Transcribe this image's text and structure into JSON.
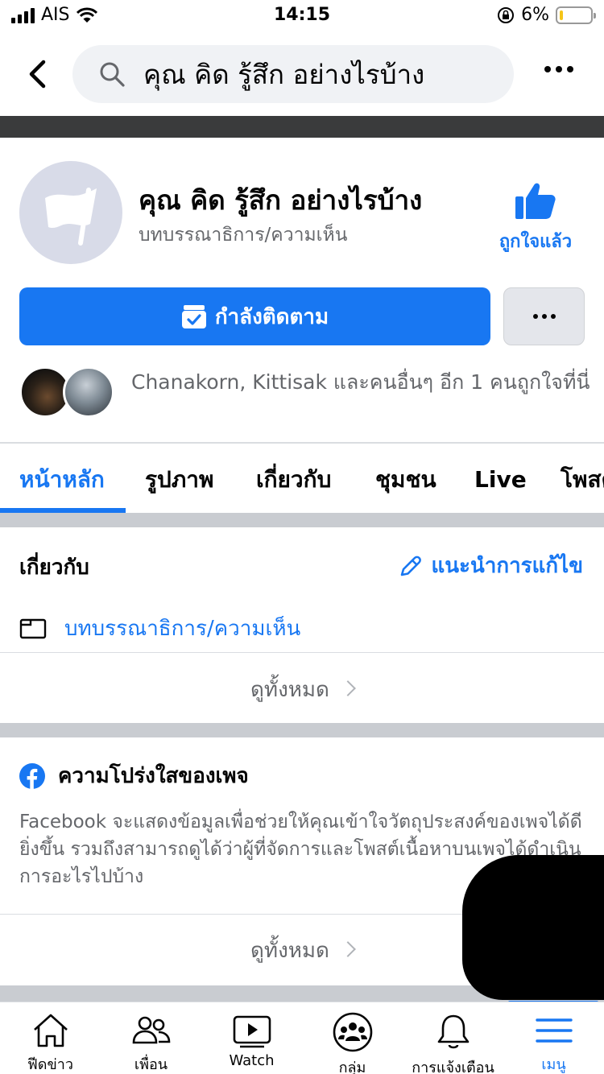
{
  "status_bar": {
    "carrier": "AIS",
    "time": "14:15",
    "battery": "6%",
    "battery_level": 0.06
  },
  "header": {
    "search_text": "คุณ คิด รู้สึก อย่างไรบ้าง"
  },
  "page": {
    "name": "คุณ คิด รู้สึก อย่างไรบ้าง",
    "category": "บทบรรณาธิการ/ความเห็น",
    "liked_label": "ถูกใจแล้ว",
    "follow_label": "กำลังติดตาม",
    "friends_text": "Chanakorn, Kittisak และคนอื่นๆ อีก 1 คนถูกใจที่นี่"
  },
  "tabs": [
    {
      "label": "หน้าหลัก",
      "active": true
    },
    {
      "label": "รูปภาพ",
      "active": false
    },
    {
      "label": "เกี่ยวกับ",
      "active": false
    },
    {
      "label": "ชุมชน",
      "active": false
    },
    {
      "label": "Live",
      "active": false
    },
    {
      "label": "โพสต์",
      "active": false
    }
  ],
  "about": {
    "title": "เกี่ยวกับ",
    "suggest_edit": "แนะนำการแก้ไข",
    "category": "บทบรรณาธิการ/ความเห็น",
    "see_all": "ดูทั้งหมด"
  },
  "transparency": {
    "title": "ความโปร่งใสของเพจ",
    "body": "Facebook จะแสดงข้อมูลเพื่อช่วยให้คุณเข้าใจวัตถุประสงค์ของเพจได้ดียิ่งขึ้น รวมถึงสามารถดูได้ว่าผู้ที่จัดการและโพสต์เนื้อหาบนเพจได้ดำเนินการอะไรไปบ้าง",
    "see_all": "ดูทั้งหมด"
  },
  "bottom_nav": [
    {
      "label": "ฟีดข่าว",
      "icon": "home-icon"
    },
    {
      "label": "เพื่อน",
      "icon": "friends-icon"
    },
    {
      "label": "Watch",
      "icon": "watch-icon"
    },
    {
      "label": "กลุ่ม",
      "icon": "groups-icon"
    },
    {
      "label": "การแจ้งเตือน",
      "icon": "bell-icon"
    },
    {
      "label": "เมนู",
      "icon": "menu-icon",
      "active": true
    }
  ],
  "colors": {
    "accent": "#1877f2",
    "secondary_text": "#65676b",
    "divider": "#c9ccd1"
  }
}
